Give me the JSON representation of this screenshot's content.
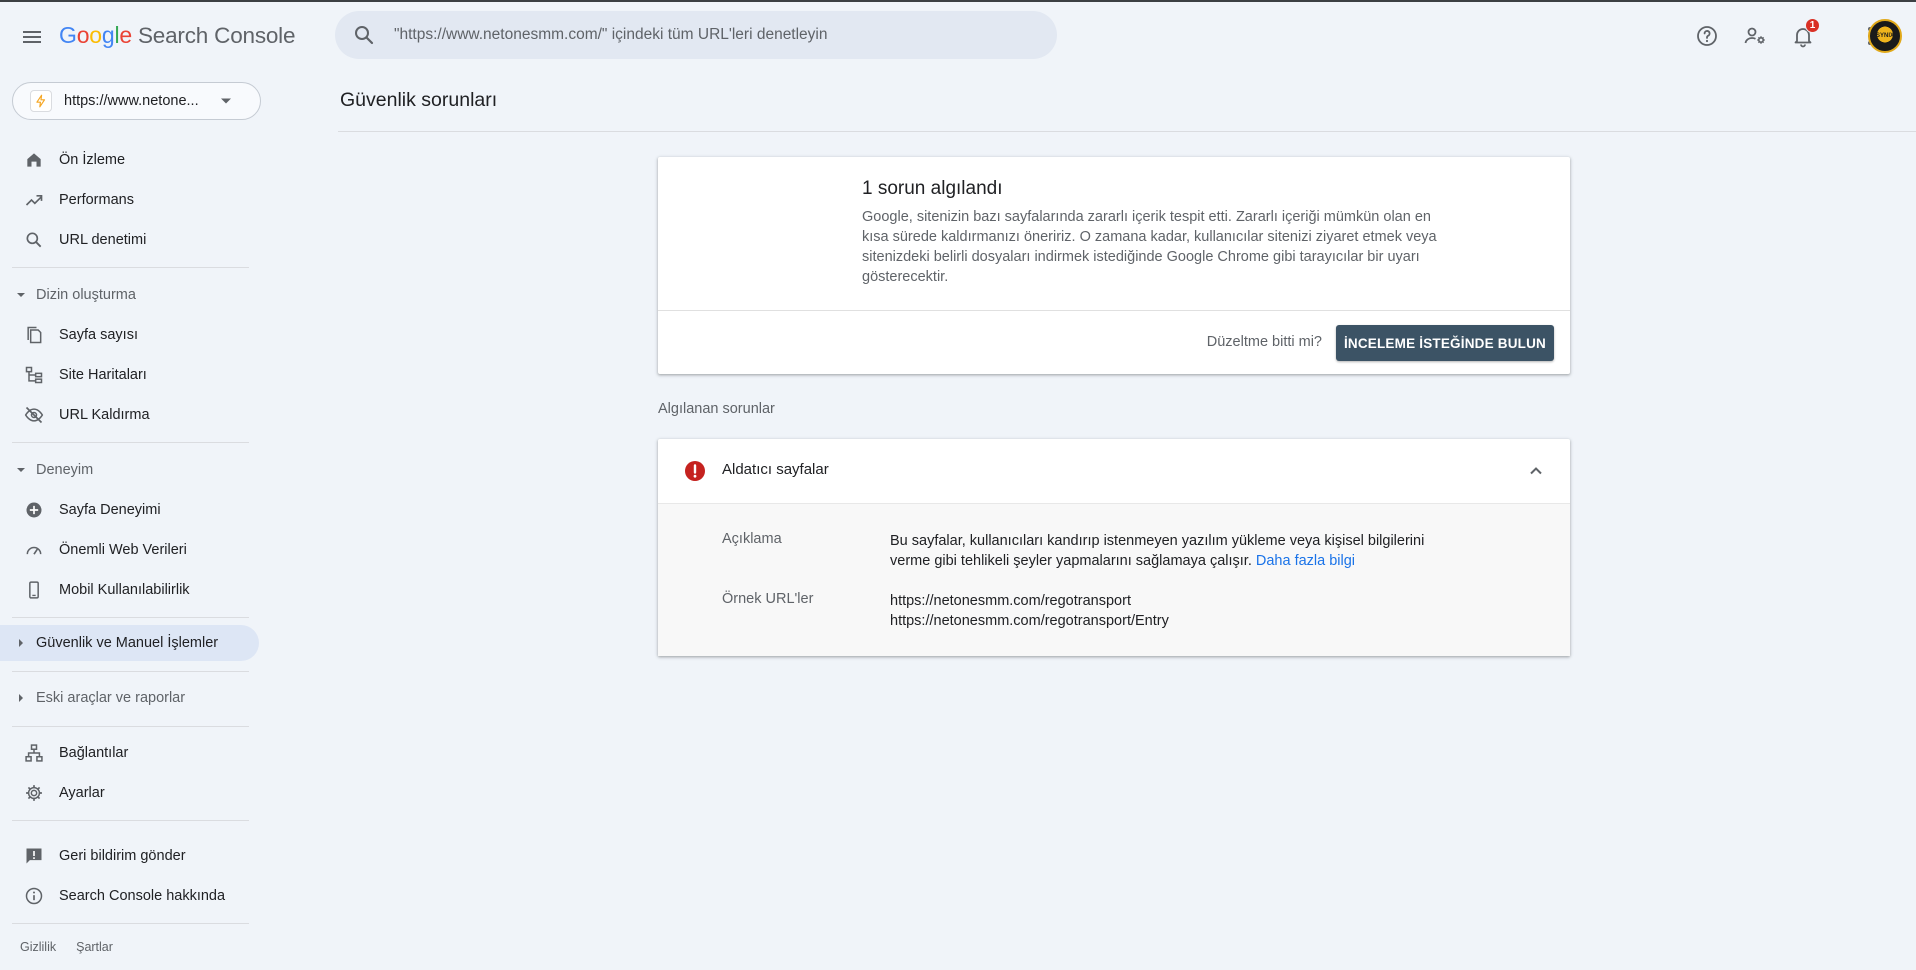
{
  "app": {
    "brand_letters": [
      "G",
      "o",
      "o",
      "g",
      "l",
      "e"
    ],
    "brand_colors": [
      "#4285f4",
      "#ea4335",
      "#fbbc05",
      "#4285f4",
      "#34a853",
      "#ea4335"
    ],
    "product_name": "Search Console"
  },
  "search": {
    "placeholder": "\"https://www.netonesmm.com/\" içindeki tüm URL'leri denetleyin"
  },
  "header_icons": [
    "help-icon",
    "manage-users-icon",
    "notifications-icon",
    "apps-grid-icon",
    "account-avatar"
  ],
  "notifications": {
    "count": "1"
  },
  "avatar_text": "SYNIX",
  "property": {
    "url": "https://www.netone..."
  },
  "sidebar": {
    "overview": "Ön İzleme",
    "performance": "Performans",
    "url_inspection": "URL denetimi",
    "indexing_section": "Dizin oluşturma",
    "pages": "Sayfa sayısı",
    "sitemaps": "Site Haritaları",
    "removals": "URL Kaldırma",
    "experience_section": "Deneyim",
    "page_experience": "Sayfa Deneyimi",
    "core_web_vitals": "Önemli Web Verileri",
    "mobile_usability": "Mobil Kullanılabilirlik",
    "security_section": "Güvenlik ve Manuel İşlemler",
    "legacy_section": "Eski araçlar ve raporlar",
    "links": "Bağlantılar",
    "settings": "Ayarlar",
    "feedback": "Geri bildirim gönder",
    "about": "Search Console hakkında",
    "privacy": "Gizlilik",
    "terms": "Şartlar"
  },
  "page": {
    "title": "Güvenlik sorunları"
  },
  "summary": {
    "title": "1 sorun algılandı",
    "body": "Google, sitenizin bazı sayfalarında zararlı içerik tespit etti. Zararlı içeriği mümkün olan en kısa sürede kaldırmanızı öneririz. O zamana kadar, kullanıcılar sitenizi ziyaret etmek veya sitenizdeki belirli dosyaları indirmek istediğinde Google Chrome gibi tarayıcılar bir uyarı gösterecektir.",
    "question": "Düzeltme bitti mi?",
    "review_button": "İNCELEME İSTEĞİNDE BULUN"
  },
  "detected": {
    "label": "Algılanan sorunlar",
    "issue_title": "Aldatıcı sayfalar",
    "description_label": "Açıklama",
    "description_text": "Bu sayfalar, kullanıcıları kandırıp istenmeyen yazılım yükleme veya kişisel bilgilerini verme gibi tehlikeli şeyler yapmalarını sağlamaya çalışır.",
    "learn_more": "Daha fazla bilgi",
    "urls_label": "Örnek URL'ler",
    "urls": [
      "https://netonesmm.com/regotransport",
      "https://netonesmm.com/regotransport/Entry"
    ]
  },
  "colors": {
    "background": "#f0f4f9",
    "review_button": "#3c5365",
    "error": "#c5221f",
    "link": "#1a73e8",
    "active_nav": "#dde6f5"
  }
}
